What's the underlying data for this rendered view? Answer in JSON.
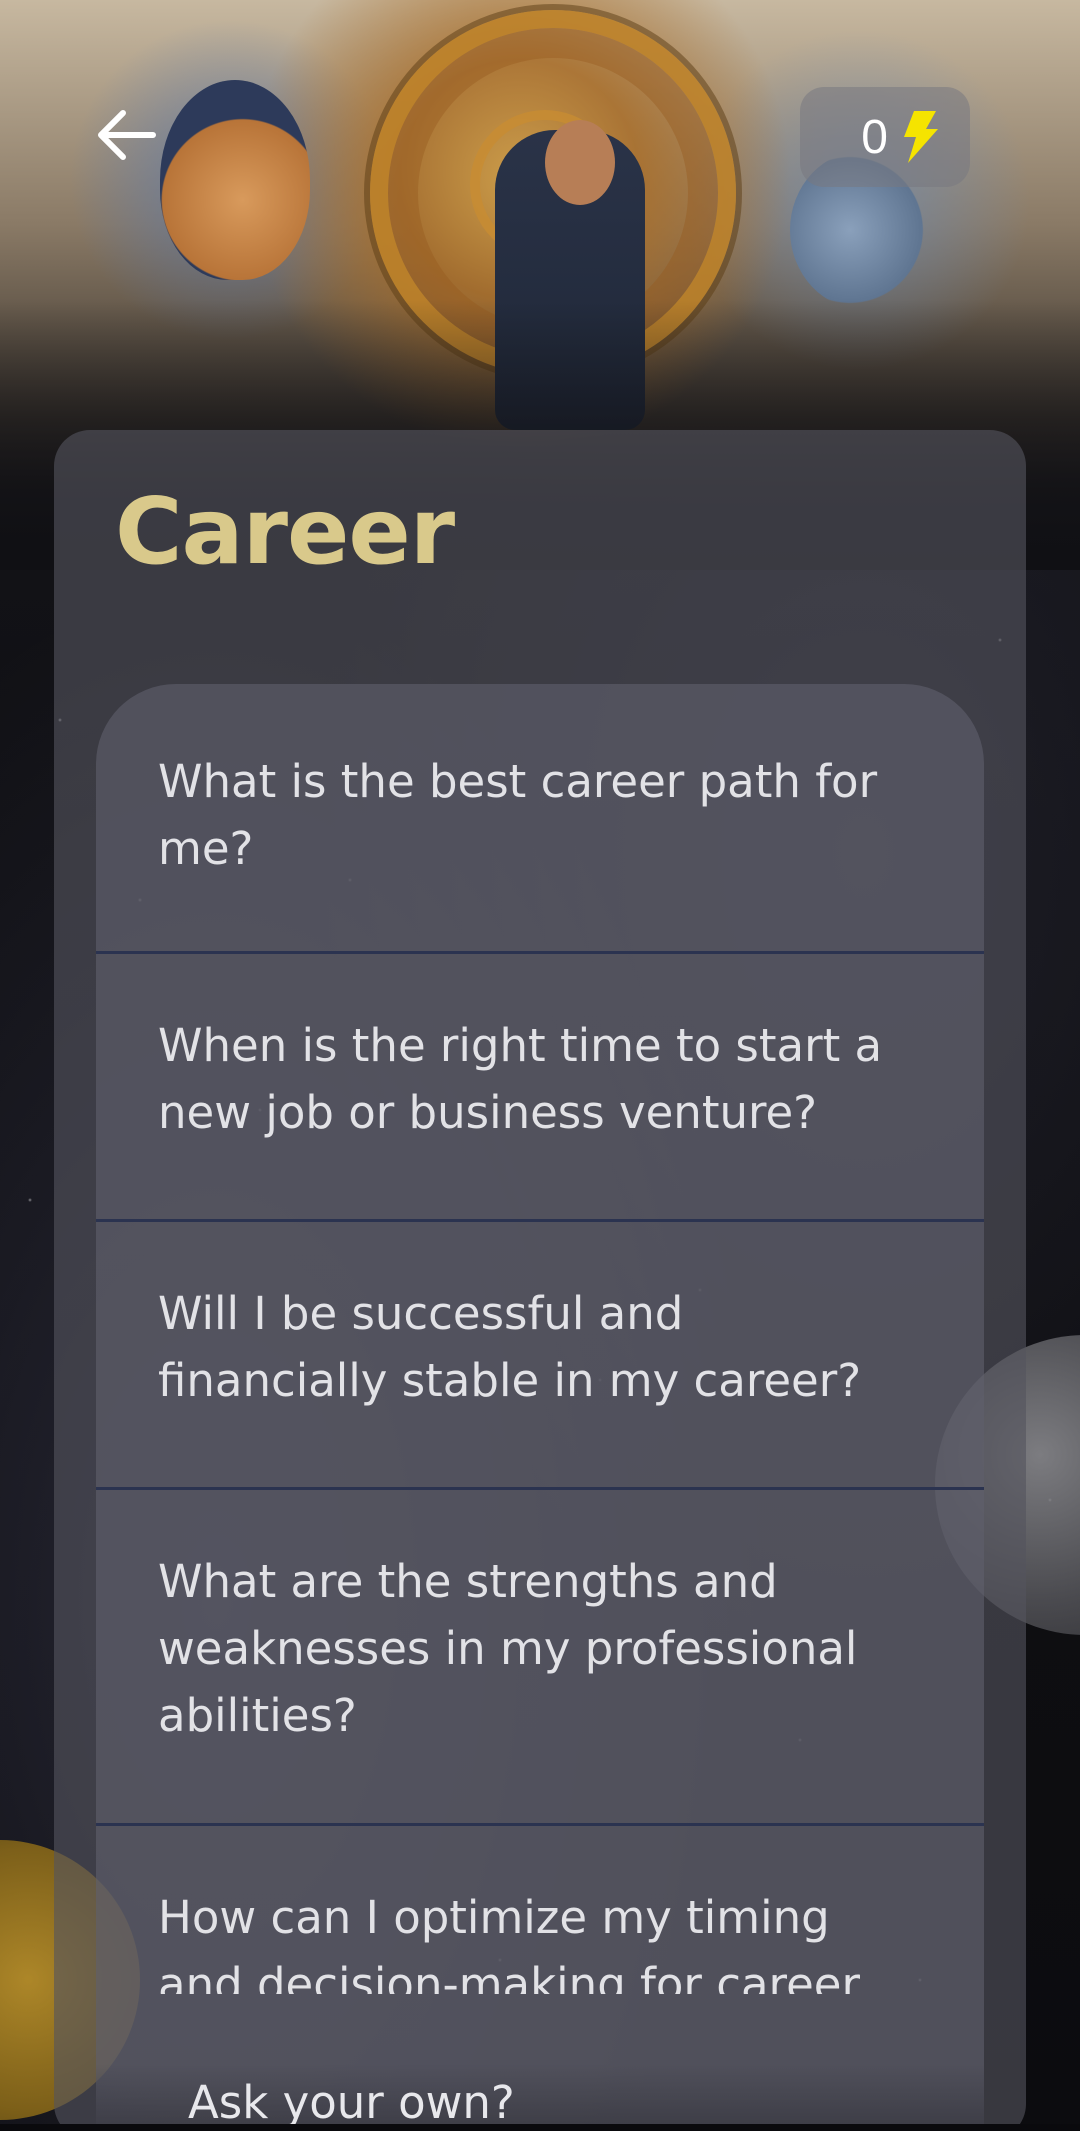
{
  "header": {
    "back_icon": "arrow-left-icon",
    "credits_count": "0",
    "credits_icon": "lightning-bolt-icon",
    "credits_icon_color": "#f5e400"
  },
  "card": {
    "title": "Career",
    "title_color": "#d9c98b"
  },
  "questions": [
    {
      "text": "What is the best career path for me?"
    },
    {
      "text": "When is the right time to start a new job or business venture?"
    },
    {
      "text": "Will I be successful and financially stable in my career?"
    },
    {
      "text": "What are the strengths and weaknesses in my professional abilities?"
    },
    {
      "text": "How can I optimize my timing and decision-making for career"
    }
  ],
  "ask_own": {
    "label": "Ask your own?"
  }
}
